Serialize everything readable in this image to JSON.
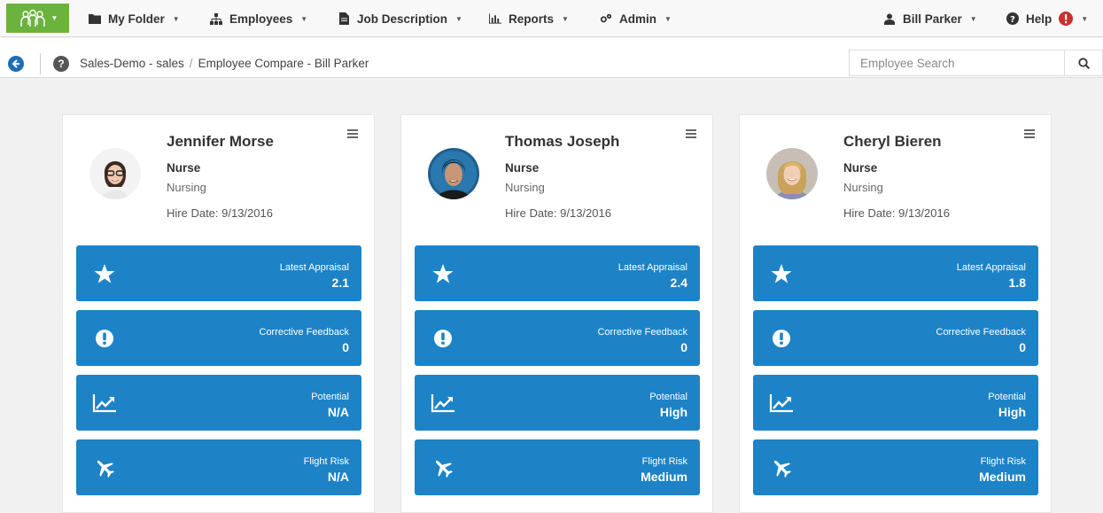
{
  "nav": {
    "my_folder": "My Folder",
    "employees": "Employees",
    "job_description": "Job Description",
    "reports": "Reports",
    "admin": "Admin",
    "user": "Bill Parker",
    "help": "Help"
  },
  "colors": {
    "brand_green": "#6cb33e",
    "tile_blue": "#1d83c6",
    "link_blue": "#1e6fb8",
    "alert_red": "#c9302c"
  },
  "breadcrumb": {
    "items": [
      "Sales-Demo - sales",
      "Employee Compare - Bill Parker"
    ]
  },
  "search": {
    "placeholder": "Employee Search",
    "value": ""
  },
  "employees": [
    {
      "name": "Jennifer Morse",
      "title": "Nurse",
      "department": "Nursing",
      "hire_date": "Hire Date: 9/13/2016",
      "stats": [
        {
          "label": "Latest Appraisal",
          "value": "2.1",
          "icon": "star-icon"
        },
        {
          "label": "Corrective Feedback",
          "value": "0",
          "icon": "exclamation-circle-icon"
        },
        {
          "label": "Potential",
          "value": "N/A",
          "icon": "trend-chart-icon"
        },
        {
          "label": "Flight Risk",
          "value": "N/A",
          "icon": "plane-icon"
        }
      ]
    },
    {
      "name": "Thomas Joseph",
      "title": "Nurse",
      "department": "Nursing",
      "hire_date": "Hire Date: 9/13/2016",
      "stats": [
        {
          "label": "Latest Appraisal",
          "value": "2.4",
          "icon": "star-icon"
        },
        {
          "label": "Corrective Feedback",
          "value": "0",
          "icon": "exclamation-circle-icon"
        },
        {
          "label": "Potential",
          "value": "High",
          "icon": "trend-chart-icon"
        },
        {
          "label": "Flight Risk",
          "value": "Medium",
          "icon": "plane-icon"
        }
      ]
    },
    {
      "name": "Cheryl Bieren",
      "title": "Nurse",
      "department": "Nursing",
      "hire_date": "Hire Date: 9/13/2016",
      "stats": [
        {
          "label": "Latest Appraisal",
          "value": "1.8",
          "icon": "star-icon"
        },
        {
          "label": "Corrective Feedback",
          "value": "0",
          "icon": "exclamation-circle-icon"
        },
        {
          "label": "Potential",
          "value": "High",
          "icon": "trend-chart-icon"
        },
        {
          "label": "Flight Risk",
          "value": "Medium",
          "icon": "plane-icon"
        }
      ]
    }
  ]
}
